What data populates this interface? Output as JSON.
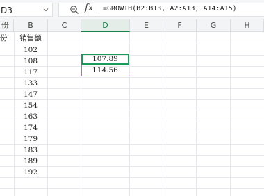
{
  "formula_bar": {
    "cell_ref": "D3",
    "fx_label": "fx",
    "formula": "=GROWTH(B2:B13, A2:A13, A14:A15)"
  },
  "columns": [
    "份",
    "B",
    "C",
    "D",
    "E",
    "F",
    "G",
    "H"
  ],
  "sheet": {
    "a_header": "份",
    "b_header": "销售额",
    "b_values": [
      "102",
      "108",
      "117",
      "133",
      "147",
      "154",
      "163",
      "174",
      "179",
      "183",
      "189",
      "192"
    ],
    "d_values": [
      "107.89",
      "114.56"
    ]
  }
}
